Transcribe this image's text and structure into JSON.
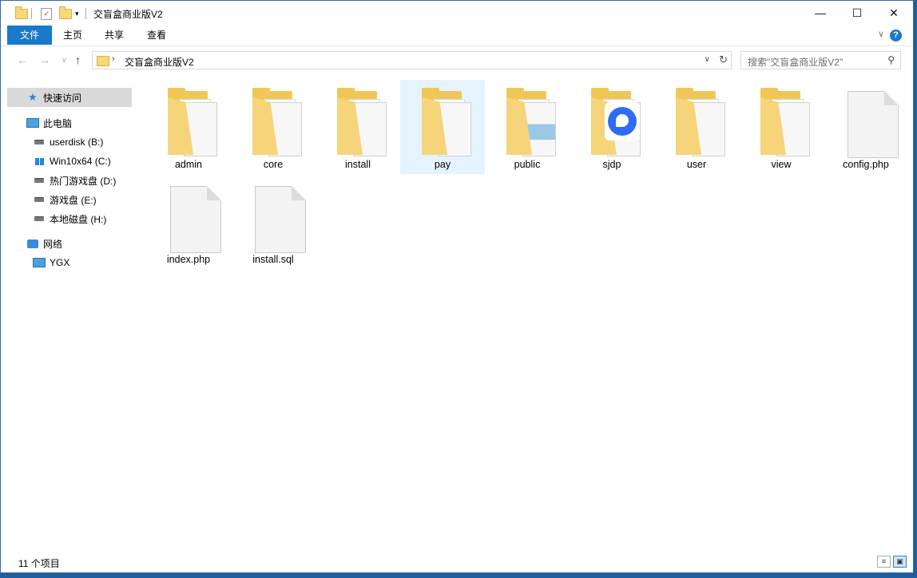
{
  "window": {
    "title": "交盲盒商业版V2"
  },
  "title_controls": {
    "minimize": "—",
    "maximize": "☐",
    "close": "✕"
  },
  "ribbon": {
    "tabs": [
      "文件",
      "主页",
      "共享",
      "查看"
    ],
    "help": "?"
  },
  "nav": {
    "address": "交盲盒商业版V2",
    "search_placeholder": "搜索\"交盲盒商业版V2\""
  },
  "sidebar": {
    "items": [
      {
        "label": "快速访问",
        "icon": "star-icon"
      },
      {
        "label": "此电脑",
        "icon": "pc-icon"
      },
      {
        "label": "userdisk (B:)",
        "icon": "drive-icon"
      },
      {
        "label": "Win10x64 (C:)",
        "icon": "windows-drive-icon"
      },
      {
        "label": "热门游戏盘 (D:)",
        "icon": "drive-icon"
      },
      {
        "label": "游戏盘 (E:)",
        "icon": "drive-icon"
      },
      {
        "label": "本地磁盘 (H:)",
        "icon": "drive-icon"
      },
      {
        "label": "网络",
        "icon": "network-icon"
      },
      {
        "label": "YGX",
        "icon": "computer-icon"
      }
    ]
  },
  "files": [
    {
      "name": "admin",
      "type": "folder"
    },
    {
      "name": "core",
      "type": "folder"
    },
    {
      "name": "install",
      "type": "folder"
    },
    {
      "name": "pay",
      "type": "folder",
      "selected": true
    },
    {
      "name": "public",
      "type": "folder"
    },
    {
      "name": "sjdp",
      "type": "folder-app"
    },
    {
      "name": "user",
      "type": "folder"
    },
    {
      "name": "view",
      "type": "folder"
    },
    {
      "name": "config.php",
      "type": "file"
    },
    {
      "name": "index.php",
      "type": "file"
    },
    {
      "name": "install.sql",
      "type": "file"
    }
  ],
  "status": {
    "count_text": "11 个项目"
  },
  "colors": {
    "accent": "#1979ca",
    "selection": "#e5f3ff",
    "folder": "#f0c756"
  }
}
